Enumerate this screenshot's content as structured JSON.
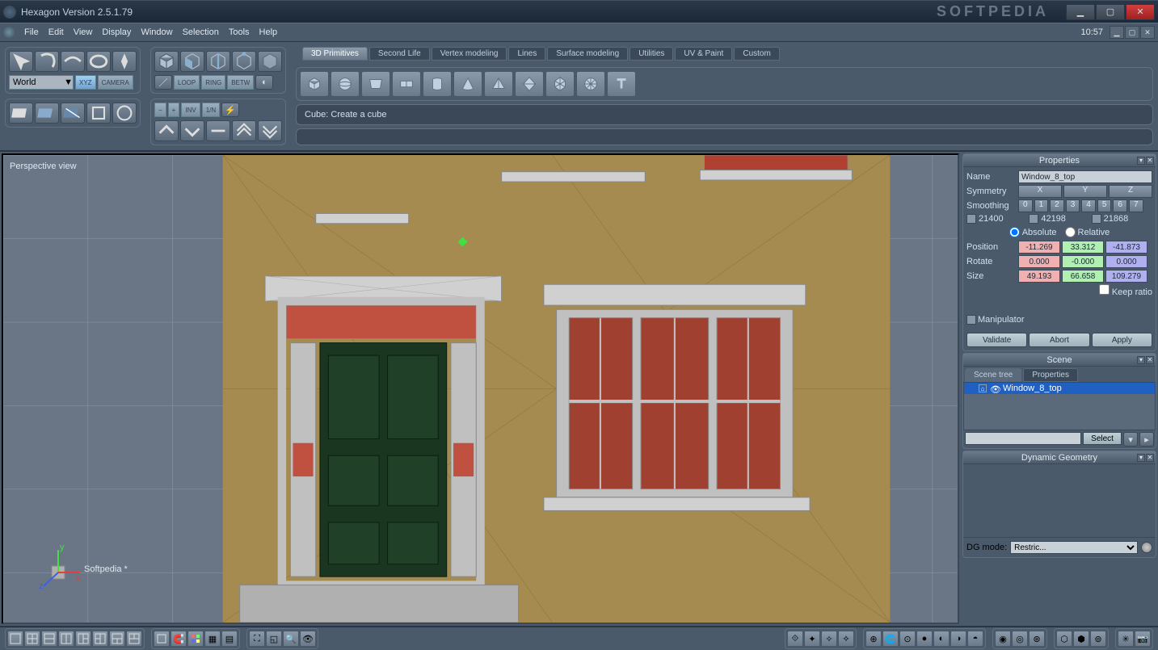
{
  "window": {
    "title": "Hexagon Version 2.5.1.79",
    "brand": "SOFTPEDIA"
  },
  "menubar": {
    "items": [
      "File",
      "Edit",
      "View",
      "Display",
      "Window",
      "Selection",
      "Tools",
      "Help"
    ],
    "time": "10:57"
  },
  "coord": {
    "system": "World",
    "xyz": "XYZ",
    "camera": "CAMERA"
  },
  "sel_buttons": [
    "LOOP",
    "RING",
    "BETW"
  ],
  "angle_buttons": [
    "−",
    "+",
    "INV",
    "1/N"
  ],
  "tabs": [
    "3D Primitives",
    "Second Life",
    "Vertex modeling",
    "Lines",
    "Surface modeling",
    "Utilities",
    "UV & Paint",
    "Custom"
  ],
  "active_tab": 0,
  "hint": "Cube: Create a cube",
  "viewport": {
    "label": "Perspective view",
    "scene_name": "Softpedia *"
  },
  "properties": {
    "title": "Properties",
    "name_label": "Name",
    "name_value": "Window_8_top",
    "symmetry_label": "Symmetry",
    "symmetry_axes": [
      "X",
      "Y",
      "Z"
    ],
    "smoothing_label": "Smoothing",
    "smoothing_levels": [
      "0",
      "1",
      "2",
      "3",
      "4",
      "5",
      "6",
      "7"
    ],
    "stats": {
      "faces": "21400",
      "edges": "42198",
      "verts": "21868"
    },
    "absolute": "Absolute",
    "relative": "Relative",
    "position_label": "Position",
    "position": {
      "x": "-11.269",
      "y": "33.312",
      "z": "-41.873"
    },
    "rotate_label": "Rotate",
    "rotate": {
      "x": "0.000",
      "y": "-0.000",
      "z": "0.000"
    },
    "size_label": "Size",
    "size": {
      "x": "49.193",
      "y": "66.658",
      "z": "109.279"
    },
    "keep_ratio": "Keep ratio",
    "manipulator": "Manipulator",
    "validate": "Validate",
    "abort": "Abort",
    "apply": "Apply"
  },
  "scene": {
    "title": "Scene",
    "tab1": "Scene tree",
    "tab2": "Properties",
    "item": "Window_8_top",
    "select": "Select"
  },
  "dg": {
    "title": "Dynamic Geometry",
    "mode_label": "DG mode:",
    "mode_value": "Restric..."
  }
}
